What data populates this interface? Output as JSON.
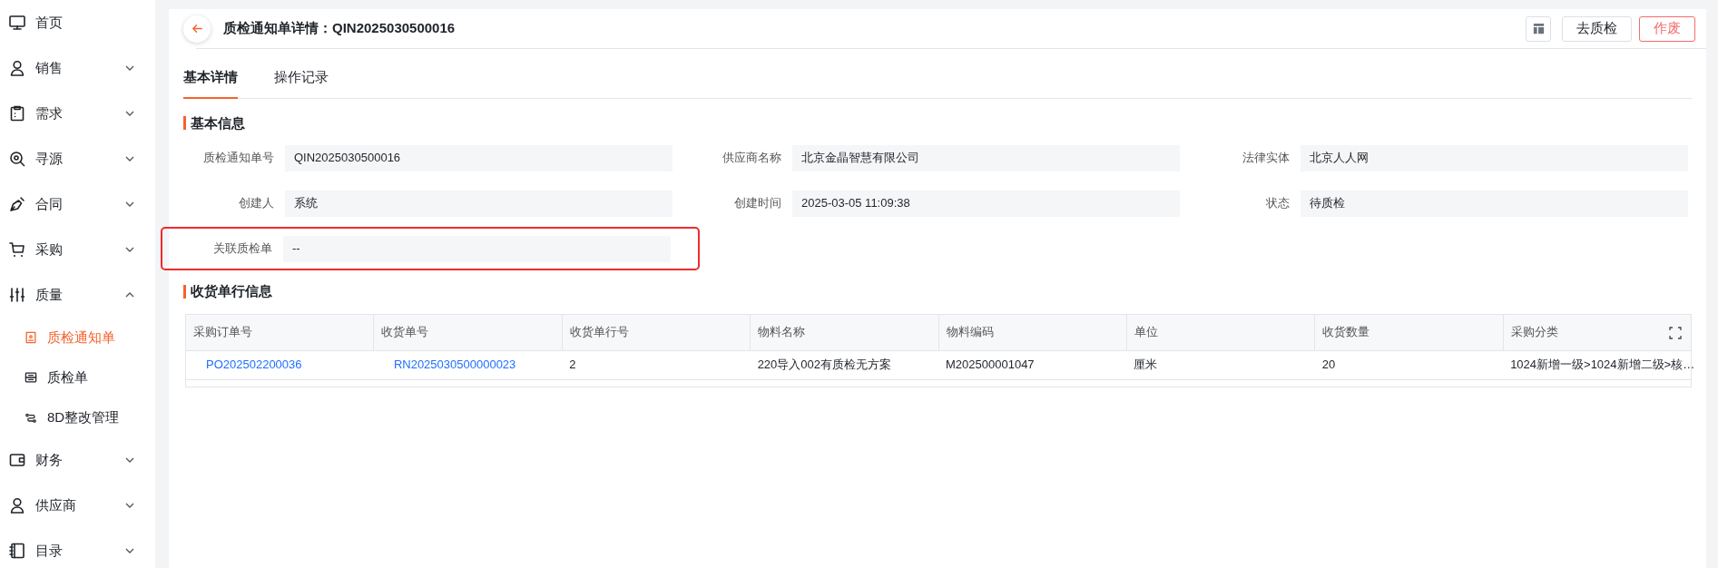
{
  "sidebar": {
    "items": [
      {
        "label": "首页"
      },
      {
        "label": "销售",
        "expanded": false
      },
      {
        "label": "需求",
        "expanded": false
      },
      {
        "label": "寻源",
        "expanded": false
      },
      {
        "label": "合同",
        "expanded": false
      },
      {
        "label": "采购",
        "expanded": false
      },
      {
        "label": "质量",
        "expanded": true,
        "children": [
          {
            "label": "质检通知单",
            "selected": true
          },
          {
            "label": "质检单",
            "selected": false
          },
          {
            "label": "8D整改管理",
            "selected": false
          }
        ]
      },
      {
        "label": "财务",
        "expanded": false
      },
      {
        "label": "供应商",
        "expanded": false
      },
      {
        "label": "目录",
        "expanded": false
      }
    ]
  },
  "header": {
    "title": "质检通知单详情：QIN2025030500016",
    "buttons": [
      {
        "label": "去质检",
        "kind": "default"
      },
      {
        "label": "作废",
        "kind": "danger"
      }
    ]
  },
  "tabs": [
    {
      "label": "基本详情",
      "selected": true
    },
    {
      "label": "操作记录",
      "selected": false
    }
  ],
  "basic_info": {
    "title": "基本信息",
    "fields": [
      {
        "label": "质检通知单号",
        "value": "QIN2025030500016",
        "highlighted": false
      },
      {
        "label": "供应商名称",
        "value": "北京金晶智慧有限公司",
        "highlighted": false
      },
      {
        "label": "法律实体",
        "value": "北京人人网",
        "highlighted": false
      },
      {
        "label": "创建人",
        "value": "系统",
        "highlighted": false
      },
      {
        "label": "创建时间",
        "value": "2025-03-05 11:09:38",
        "highlighted": false
      },
      {
        "label": "状态",
        "value": "待质检",
        "highlighted": false
      },
      {
        "label": "关联质检单",
        "value": "--",
        "highlighted": true
      }
    ]
  },
  "receipt_lines": {
    "title": "收货单行信息",
    "columns": [
      "采购订单号",
      "收货单号",
      "收货单行号",
      "物料名称",
      "物料编码",
      "单位",
      "收货数量",
      "采购分类"
    ],
    "rows": [
      [
        {
          "text": "PO202502200036",
          "link": true
        },
        {
          "text": "RN2025030500000023",
          "link": true
        },
        {
          "text": "2",
          "link": false
        },
        {
          "text": "220导入002有质检无方案",
          "link": false
        },
        {
          "text": "M202500001047",
          "link": false
        },
        {
          "text": "厘米",
          "link": false
        },
        {
          "text": "20",
          "link": false
        },
        {
          "text": "1024新增一级>1024新增二级>核…",
          "link": false
        }
      ]
    ]
  }
}
